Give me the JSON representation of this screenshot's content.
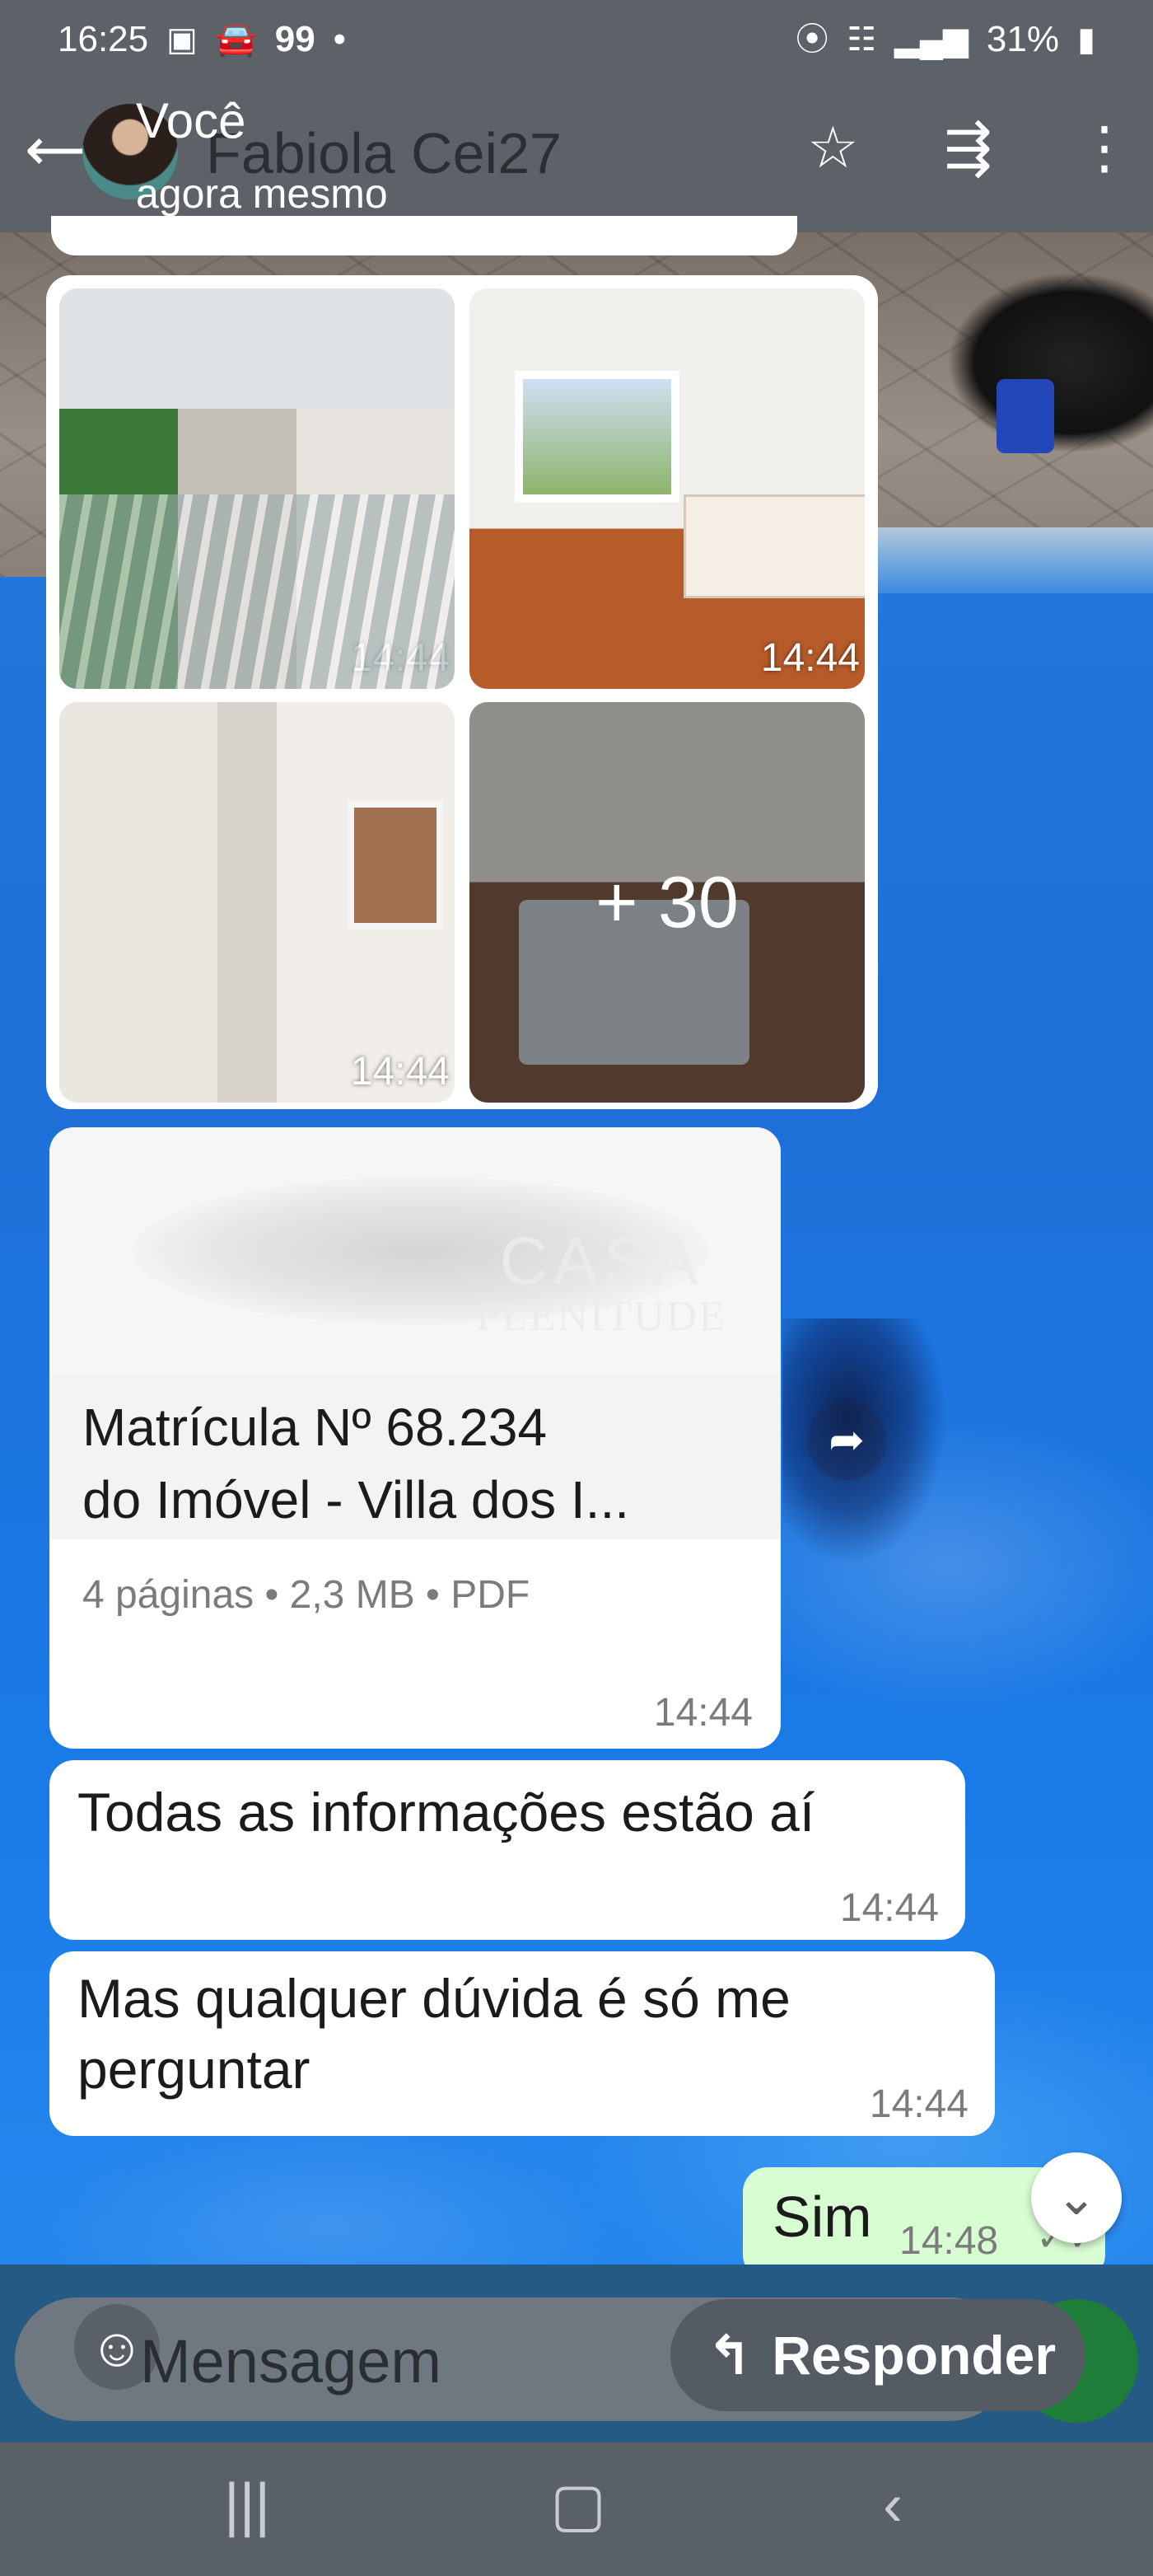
{
  "status_bar": {
    "time": "16:25",
    "left_icons": [
      "image-icon",
      "car-icon"
    ],
    "notif": "99",
    "dot": "•",
    "battery": "31%",
    "right_icons": [
      "location-icon",
      "wifi-icon",
      "signal-icon",
      "battery-icon"
    ]
  },
  "header": {
    "contact_name": "Fabiola Cei27",
    "overlay_sender": "Você",
    "overlay_time": "agora mesmo",
    "icons": [
      "back-icon",
      "star-icon",
      "forward-icon",
      "more-icon"
    ]
  },
  "messages": {
    "photos": {
      "items": [
        {
          "time": "14:44"
        },
        {
          "time": "14:44"
        },
        {
          "time": "14:44"
        },
        {
          "more": "+ 30"
        }
      ]
    },
    "document": {
      "title_line1": "Matrícula Nº 68.234",
      "title_line2": "do Imóvel - Villa dos I...",
      "meta": "4 páginas • 2,3 MB • PDF",
      "time": "14:44"
    },
    "text1": {
      "text": "Todas as informações estão aí",
      "time": "14:44"
    },
    "text2": {
      "line1": "Mas qualquer dúvida é só me",
      "line2": "perguntar",
      "time": "14:44"
    },
    "outgoing": {
      "text": "Sim",
      "time": "14:48"
    }
  },
  "watermark": {
    "line1": "CASA",
    "line2": "PLENITUDE"
  },
  "composer": {
    "placeholder": "Mensagem",
    "reply_label": "Responder"
  },
  "colors": {
    "header_bg": "#5d6268",
    "incoming_bubble": "#ffffff",
    "outgoing_bubble": "#d9fdd3",
    "mic_green": "#1e7d38"
  }
}
